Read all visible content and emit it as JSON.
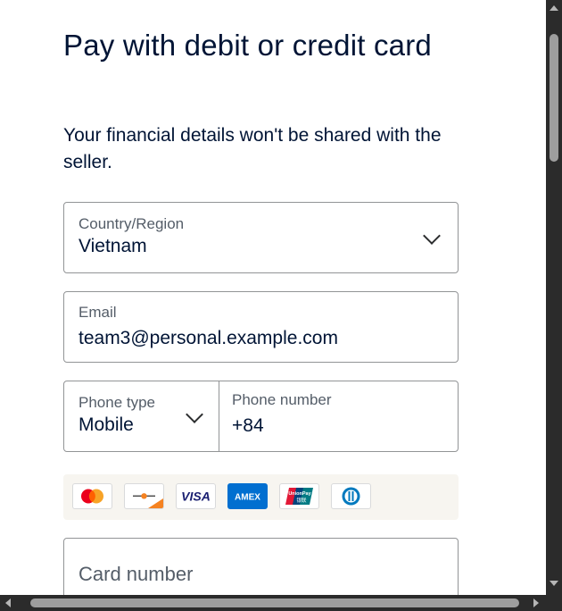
{
  "header": {
    "title": "Pay with debit or credit card",
    "subtitle": "Your financial details won't be shared with the seller."
  },
  "form": {
    "country": {
      "label": "Country/Region",
      "value": "Vietnam"
    },
    "email": {
      "label": "Email",
      "value": "team3@personal.example.com"
    },
    "phone_type": {
      "label": "Phone type",
      "value": "Mobile"
    },
    "phone_number": {
      "label": "Phone number",
      "value": "+84"
    },
    "card_number": {
      "placeholder": "Card number"
    }
  },
  "card_brands": [
    "mastercard-icon",
    "discover-icon",
    "visa-icon",
    "amex-icon",
    "unionpay-icon",
    "diners-club-icon"
  ],
  "card_text": {
    "visa": "VISA",
    "amex": "AMEX",
    "unionpay_top": "UnionPay",
    "unionpay_bottom": "银联"
  },
  "colors": {
    "text_primary": "#001435",
    "label": "#545d68",
    "border": "#929496",
    "card_strip": "#f7f5f0",
    "amex_blue": "#016fd0",
    "visa_blue": "#1a1f71"
  }
}
